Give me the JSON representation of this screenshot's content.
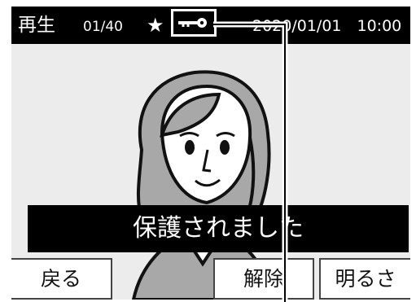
{
  "status_bar": {
    "mode": "再生",
    "counter": "01/40",
    "favorite_icon": "star-icon",
    "protect_icon": "key-icon",
    "datetime": "2020/01/01　10:00"
  },
  "image": {
    "subject": "woman-portrait-illustration"
  },
  "message": "保護されました",
  "buttons": {
    "back": "戻る",
    "release": "解除",
    "brightness": "明るさ"
  },
  "colors": {
    "bar": "#000000",
    "screen": "#ececec",
    "text_on_bar": "#ffffff"
  }
}
